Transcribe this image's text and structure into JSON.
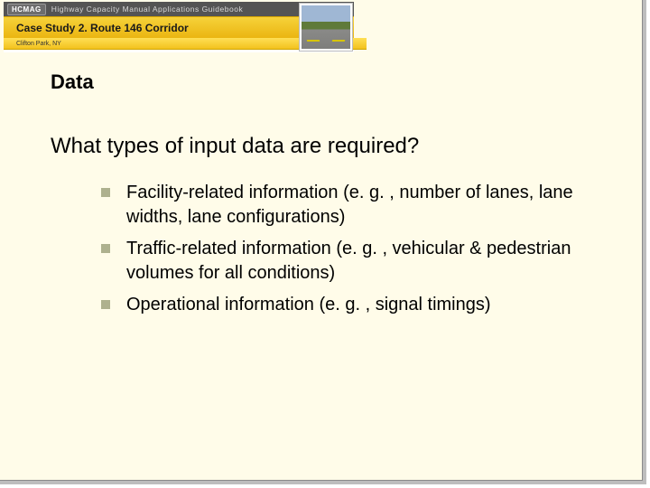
{
  "banner": {
    "logo_text": "HCMAG",
    "top_text": "Highway Capacity Manual Applications Guidebook",
    "case_study": "Case Study 2. Route 146 Corridor",
    "location": "Clifton Park, NY"
  },
  "title": "Data",
  "subtitle": "What types of input data are required?",
  "bullets": [
    "Facility-related information (e. g. , number of lanes, lane widths, lane configurations)",
    "Traffic-related information (e. g. , vehicular & pedestrian volumes for all conditions)",
    "Operational information (e. g. , signal timings)"
  ]
}
